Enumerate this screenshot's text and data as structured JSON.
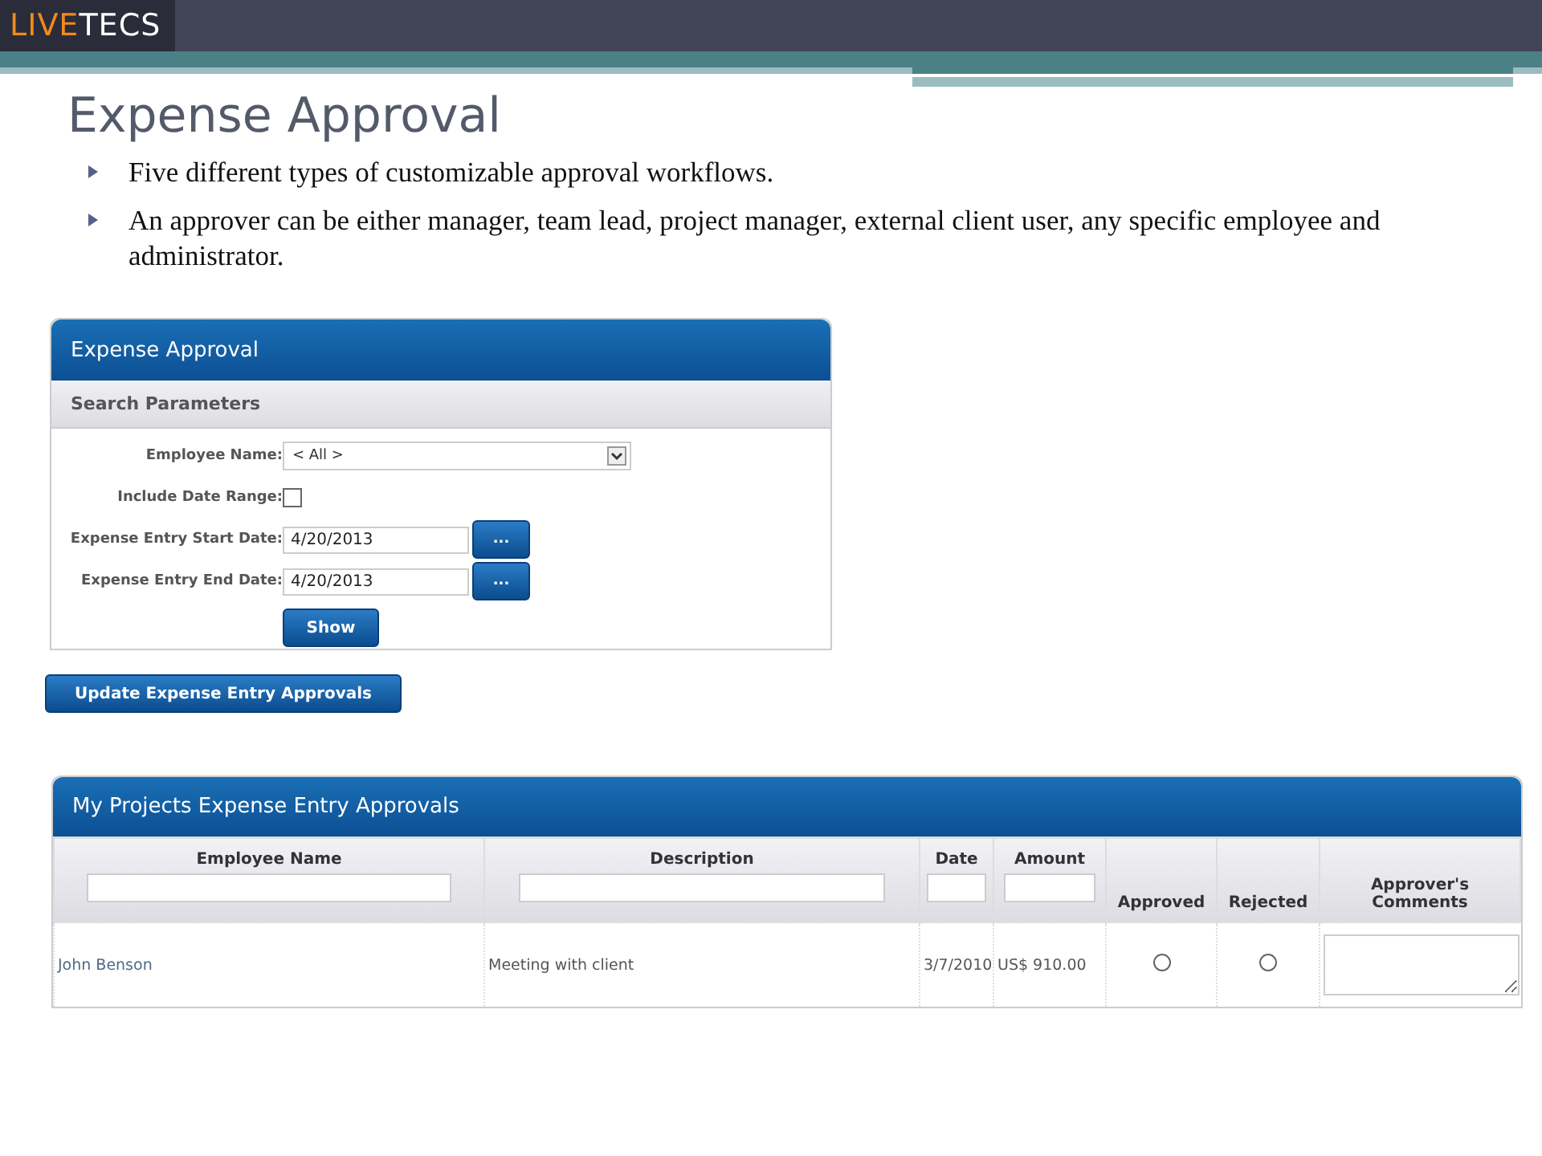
{
  "logo": {
    "part_1": "LIVE",
    "part_2": "TECS"
  },
  "title": "Expense Approval",
  "bullets": [
    "Five different types of customizable approval workflows.",
    "An approver can be either manager, team lead, project manager, external client user, any specific employee and administrator."
  ],
  "search_panel": {
    "title": "Expense Approval",
    "section": "Search Parameters",
    "fields": [
      {
        "kind": "select",
        "label": "Employee Name:",
        "value": "< All >"
      },
      {
        "kind": "checkbox",
        "label": "Include Date Range:",
        "checked": false
      },
      {
        "kind": "date",
        "label": "Expense Entry Start Date:",
        "value": "4/20/2013",
        "button": "..."
      },
      {
        "kind": "date",
        "label": "Expense Entry End Date:",
        "value": "4/20/2013",
        "button": "..."
      }
    ],
    "show_button": "Show"
  },
  "update_button": "Update Expense Entry Approvals",
  "approvals": {
    "title": "My Projects Expense Entry Approvals",
    "columns": [
      {
        "label": "Employee Name",
        "filter": true
      },
      {
        "label": "Description",
        "filter": true
      },
      {
        "label": "Date",
        "filter": true
      },
      {
        "label": "Amount",
        "filter": true
      },
      {
        "label": "Approved",
        "filter": false
      },
      {
        "label": "Rejected",
        "filter": false
      },
      {
        "label": "Approver's Comments",
        "filter": false
      }
    ],
    "rows": [
      {
        "employee": "John Benson",
        "description": "Meeting with client",
        "date": "3/7/2010",
        "amount": "US$ 910.00",
        "approved": false,
        "rejected": false
      }
    ]
  }
}
